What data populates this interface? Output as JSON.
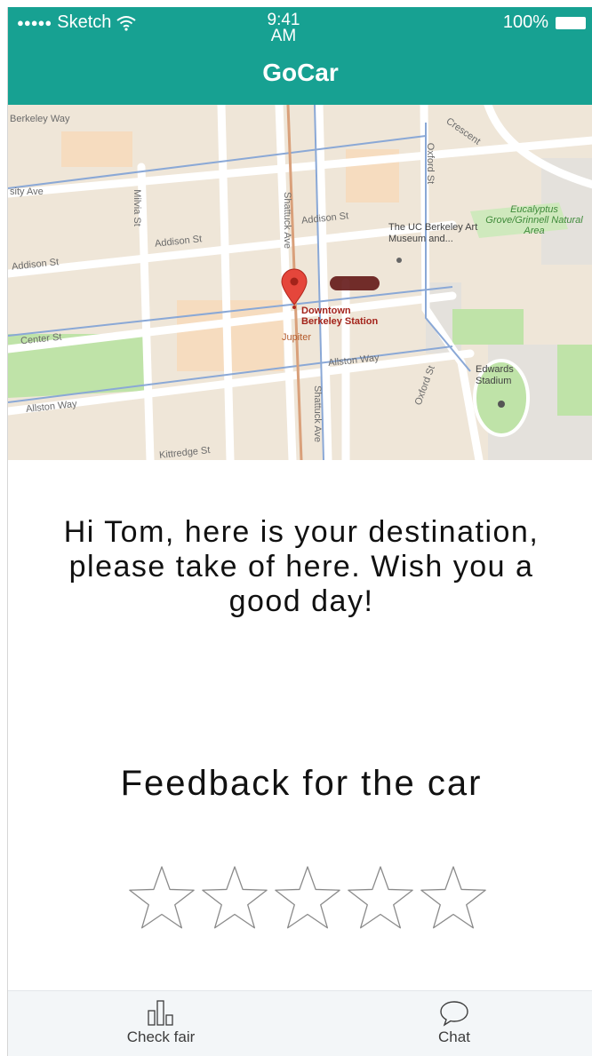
{
  "status_bar": {
    "signal": "●●●●●",
    "carrier": "Sketch",
    "time": "9:41 AM",
    "battery": "100%"
  },
  "header": {
    "title": "GoCar"
  },
  "map": {
    "streets": [
      "Berkeley Way",
      "sity Ave",
      "Addison St",
      "Addison St",
      "Addison St",
      "Center St",
      "Allston Way",
      "Allston Way",
      "Kittredge St",
      "Milvia St",
      "Shattuck Ave",
      "Shattuck Ave",
      "Oxford St",
      "Oxford St",
      "Crescent"
    ],
    "places": {
      "museum": "The UC Berkeley Art Museum and...",
      "grove": "Eucalyptus Grove/Grinnell Natural Area",
      "station": "Downtown Berkeley Station",
      "restaurant": "Jupiter",
      "stadium": "Edwards Stadium"
    },
    "colors": {
      "land": "#efe6d8",
      "road": "#ffffff",
      "transit": "#8aa8d6",
      "park": "#bfe3a8",
      "pin": "#e5463b"
    }
  },
  "content": {
    "greeting": "Hi Tom, here is your destination, please take of here. Wish you a good day!",
    "feedback_title": "Feedback for the car",
    "rating": 0,
    "max_rating": 5
  },
  "tabbar": {
    "check_fair_label": "Check fair",
    "chat_label": "Chat"
  }
}
